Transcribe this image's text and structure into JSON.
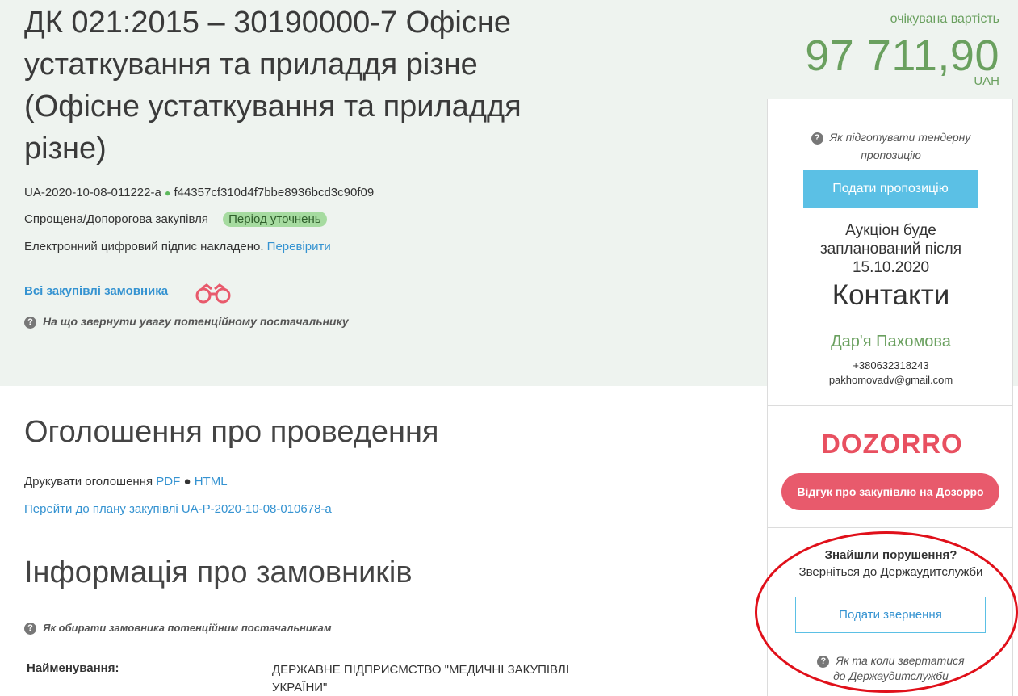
{
  "tender": {
    "title": "ДК 021:2015 – 30190000-7 Офісне устаткування та приладдя різне (Офісне устаткування та приладдя різне)",
    "id": "UA-2020-10-08-011222-a",
    "hash": "f44357cf310d4f7bbe8936bcd3c90f09",
    "procedure_type": "Спрощена/Допорогова закупівля",
    "status": "Період уточнень",
    "signature_text": "Електронний цифровий підпис накладено.",
    "signature_link": "Перевірити",
    "all_purchases_link": "Всі закупівлі замовника",
    "supplier_hint": "На що звернути увагу потенційному постачальнику"
  },
  "expected_value": {
    "label": "очікувана вартість",
    "amount": "97 711,90",
    "currency": "UAH"
  },
  "announcement": {
    "heading": "Оголошення про проведення",
    "print_label": "Друкувати оголошення",
    "pdf_link": "PDF",
    "html_link": "HTML",
    "plan_link": "Перейти до плану закупівлі UA-P-2020-10-08-010678-a"
  },
  "customers": {
    "heading": "Інформація про замовників",
    "hint": "Як обирати замовника потенційним постачальникам",
    "name_label": "Найменування:",
    "name_value": "ДЕРЖАВНЕ ПІДПРИЄМСТВО \"МЕДИЧНІ ЗАКУПІВЛІ УКРАЇНИ\""
  },
  "sidebar": {
    "prepare_hint_line1": "Як підготувати тендерну",
    "prepare_hint_line2": "пропозицію",
    "submit_offer_button": "Подати пропозицію",
    "auction_line1": "Аукціон буде",
    "auction_line2": "запланований після",
    "auction_line3": "15.10.2020",
    "contacts_heading": "Контакти",
    "contact_name": "Дар'я Пахомова",
    "contact_phone": "+380632318243",
    "contact_email": "pakhomovadv@gmail.com",
    "dozorro_logo": "DOZORRO",
    "dozorro_button": "Відгук про закупівлю на Дозорро",
    "violation_question": "Знайшли порушення?",
    "violation_sub": "Зверніться до Держаудитслужби",
    "appeal_button": "Подати звернення",
    "appeal_hint_line1": "Як та коли звертатися",
    "appeal_hint_line2": "до Держаудитслужби"
  },
  "colors": {
    "accent_green": "#6aa05f",
    "link_blue": "#3593d1",
    "button_cyan": "#5bc0e5",
    "dozorro_red": "#e85a6c",
    "annotation_red": "#e0101a"
  }
}
